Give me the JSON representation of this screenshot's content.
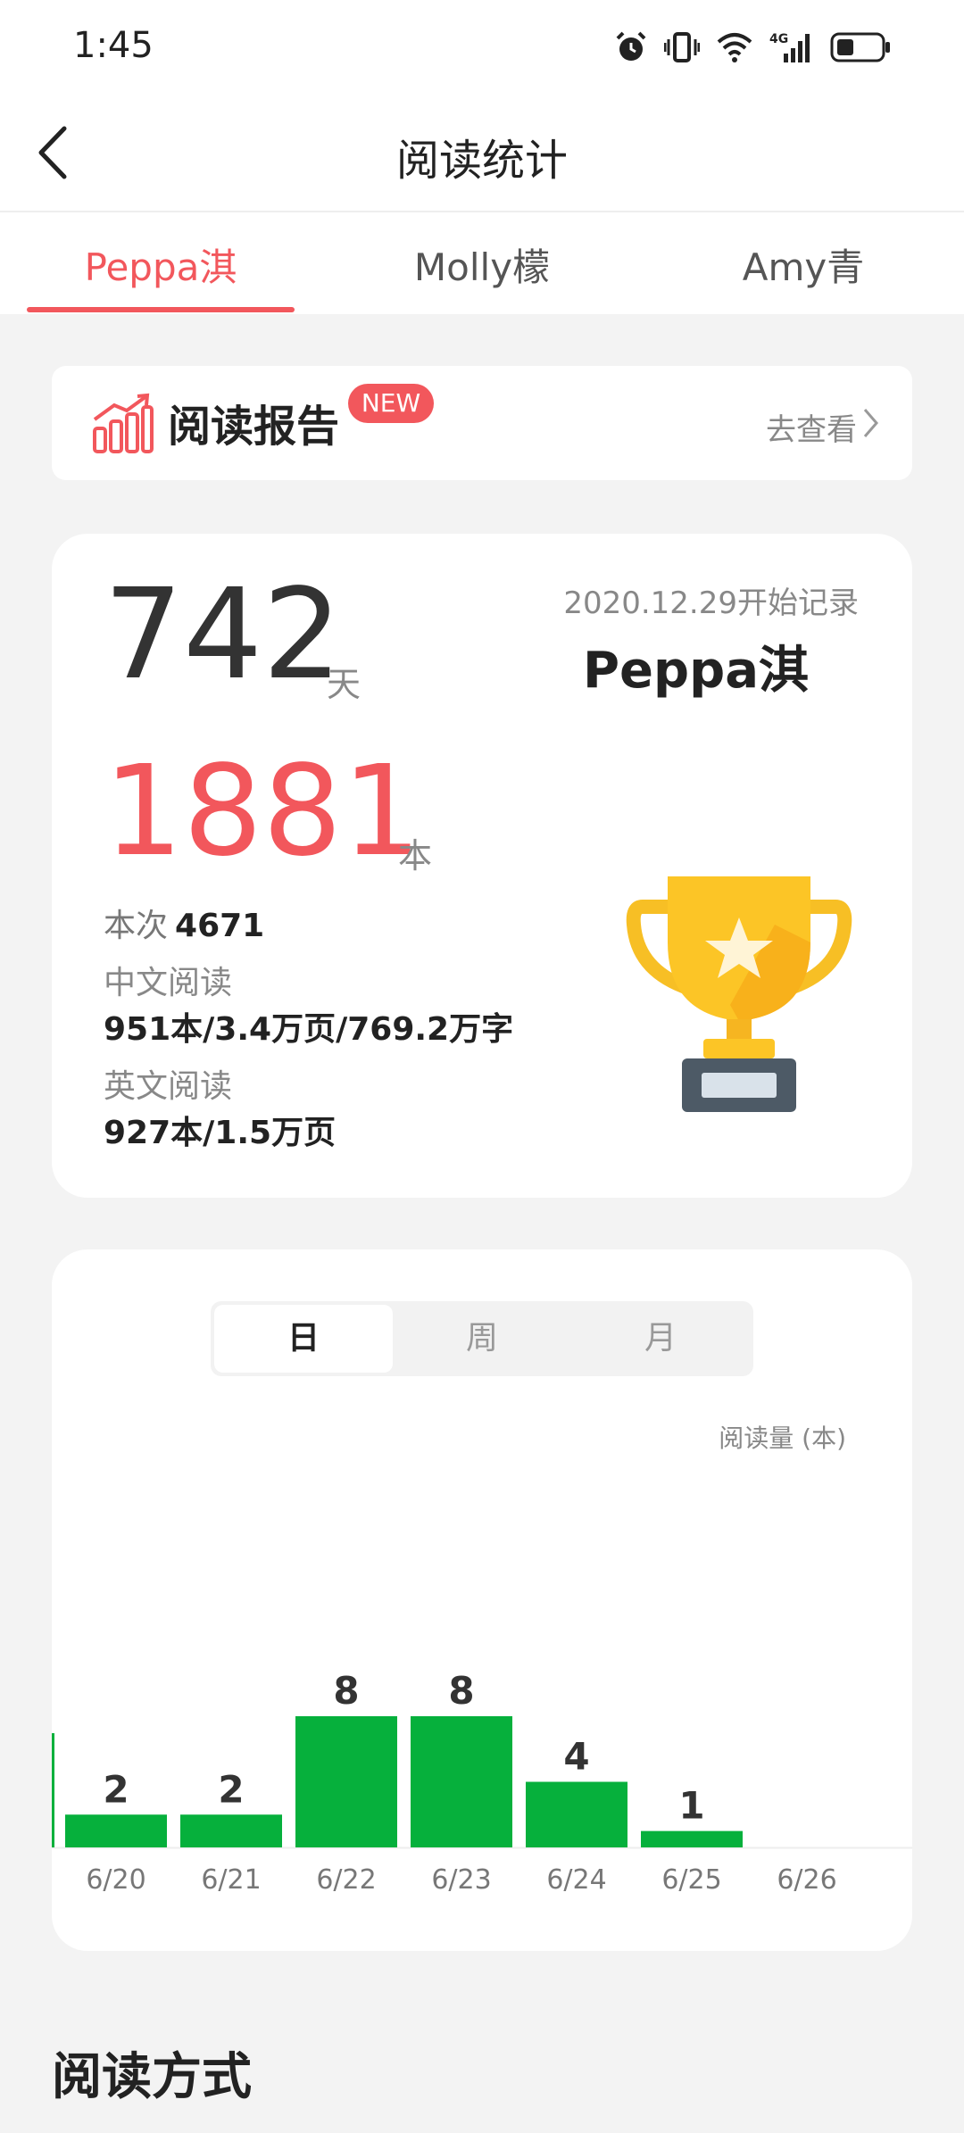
{
  "status": {
    "time": "1:45"
  },
  "nav": {
    "title": "阅读统计"
  },
  "tabs": [
    {
      "label": "Peppa淇"
    },
    {
      "label": "Molly檬"
    },
    {
      "label": "Amy青"
    }
  ],
  "report": {
    "title": "阅读报告",
    "badge": "NEW",
    "link": "去查看"
  },
  "stats": {
    "days": "742",
    "days_unit": "天",
    "books": "1881",
    "books_unit": "本",
    "since": "2020.12.29开始记录",
    "child_name": "Peppa淇",
    "session_label": "本次",
    "session_value": "4671",
    "chinese_label": "中文阅读",
    "chinese_value": "951本/3.4万页/769.2万字",
    "english_label": "英文阅读",
    "english_value": "927本/1.5万页"
  },
  "period_tabs": {
    "day": "日",
    "week": "周",
    "month": "月"
  },
  "colors": {
    "accent": "#f2575c",
    "bar": "#06b03c"
  },
  "chart_data": {
    "type": "bar",
    "ylabel": "阅读量 (本)",
    "categories": [
      "6/20",
      "6/21",
      "6/22",
      "6/23",
      "6/24",
      "6/25",
      "6/26"
    ],
    "values": [
      2,
      2,
      8,
      8,
      4,
      1,
      0
    ],
    "value_labels": [
      "2",
      "2",
      "8",
      "8",
      "4",
      "1",
      ""
    ]
  },
  "section": {
    "title": "阅读方式"
  }
}
